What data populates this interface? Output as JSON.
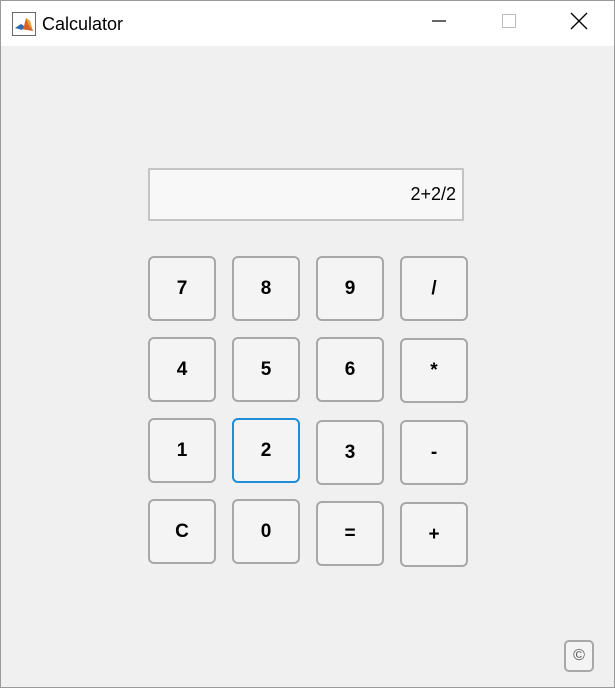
{
  "window": {
    "title": "Calculator",
    "app_icon": "matlab-logo-icon",
    "controls": [
      "minimize-icon",
      "maximize-icon",
      "close-icon"
    ]
  },
  "display": {
    "value": "2+2/2"
  },
  "keypad": {
    "rows": [
      [
        "7",
        "8",
        "9",
        "/"
      ],
      [
        "4",
        "5",
        "6",
        "*"
      ],
      [
        "1",
        "2",
        "3",
        "-"
      ],
      [
        "C",
        "0",
        "=",
        "+"
      ]
    ],
    "focused_key": "2"
  },
  "footer": {
    "copyright_label": "©"
  },
  "colors": {
    "focus_border": "#1f8ed6",
    "button_border": "#a8a8a8",
    "background": "#f0f0f0"
  }
}
